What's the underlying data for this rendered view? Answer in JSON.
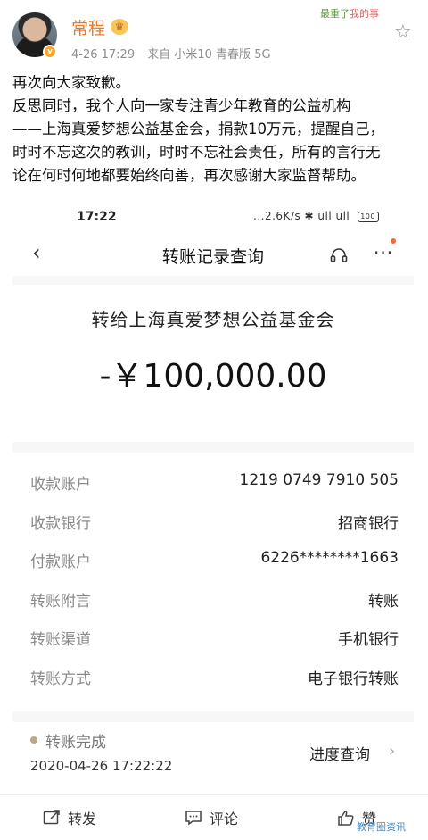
{
  "header": {
    "username": "常程",
    "verified_badge": "v",
    "timestamp": "4-26 17:29",
    "source": "来自 小米10 青春版 5G",
    "sticker_text_a": "最重了",
    "sticker_text_b": "我的事",
    "crown_icon": "crown-icon",
    "star_icon": "star-icon"
  },
  "post": {
    "lines": [
      "再次向大家致歉。",
      "反思同时，我个人向一家专注青少年教育的公益机构",
      "——上海真爱梦想公益基金会，捐款10万元，提醒自己，",
      "时时不忘这次的教训，时时不忘社会责任，所有的言行无",
      "论在何时何地都要始终向善，再次感谢大家监督帮助。"
    ]
  },
  "screenshot": {
    "status_time": "17:22",
    "status_right": "...2.6K/s ✱ ull ull",
    "battery": "100",
    "nav_title": "转账记录查询",
    "recipient": "转给上海真爱梦想公益基金会",
    "amount": "-￥100,000.00",
    "rows": [
      {
        "label": "收款账户",
        "value": "1219 0749 7910 505"
      },
      {
        "label": "收款银行",
        "value": "招商银行"
      },
      {
        "label": "付款账户",
        "value": "6226********1663"
      },
      {
        "label": "转账附言",
        "value": "转账"
      },
      {
        "label": "转账渠道",
        "value": "手机银行"
      },
      {
        "label": "转账方式",
        "value": "电子银行转账"
      }
    ],
    "status_label": "转账完成",
    "status_time_full": "2020-04-26 17:22:22",
    "progress_link": "进度查询"
  },
  "actions": {
    "repost": "转发",
    "comment": "评论",
    "like": "赞"
  },
  "watermark": "教育圈资讯",
  "colors": {
    "username": "#e8792b",
    "verified": "#f7a528",
    "status_dot": "#bca789"
  }
}
